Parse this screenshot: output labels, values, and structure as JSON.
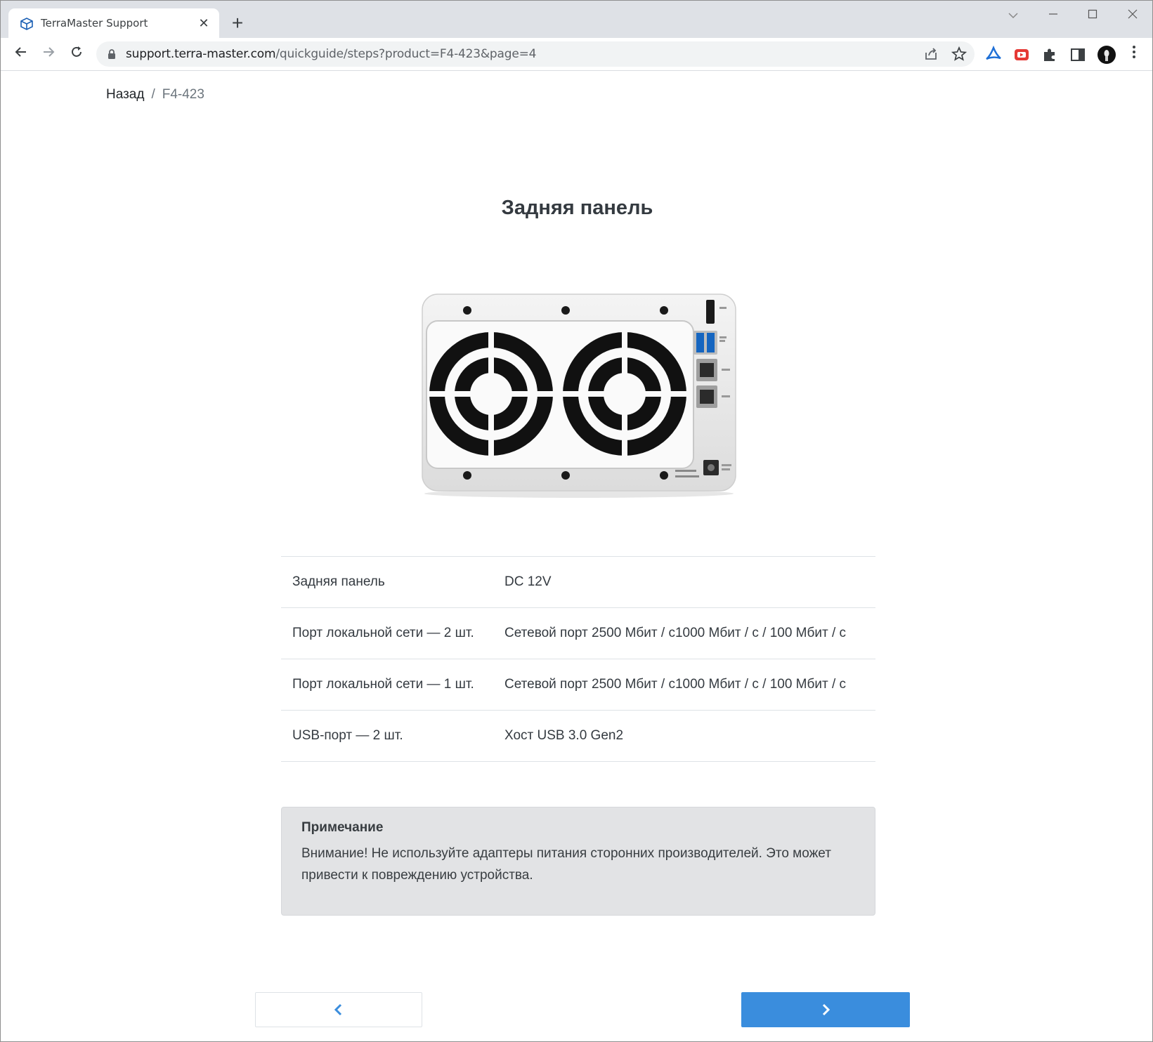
{
  "browser": {
    "tab_title": "TerraMaster Support",
    "url_host": "support.terra-master.com",
    "url_path": "/quickguide/steps?product=F4-423&page=4"
  },
  "breadcrumb": {
    "back": "Назад",
    "separator": "/",
    "current": "F4-423"
  },
  "page": {
    "title": "Задняя панель"
  },
  "specs": [
    {
      "label": "Задняя панель",
      "value": "DC 12V"
    },
    {
      "label": "Порт локальной сети — 2 шт.",
      "value": "Сетевой порт 2500 Мбит / с1000 Мбит / с / 100 Мбит / с"
    },
    {
      "label": "Порт локальной сети — 1 шт.",
      "value": "Сетевой порт 2500 Мбит / с1000 Мбит / с / 100 Мбит / с"
    },
    {
      "label": "USB-порт — 2 шт.",
      "value": "Хост USB 3.0 Gen2"
    }
  ],
  "note": {
    "title": "Примечание",
    "text": "Внимание! Не используйте адаптеры питания сторонних производителей. Это может привести к повреждению устройства."
  },
  "colors": {
    "accent": "#3a8ddd",
    "note_bg": "#e2e3e5"
  },
  "icons": {
    "prev": "chevron-left-icon",
    "next": "chevron-right-icon"
  }
}
